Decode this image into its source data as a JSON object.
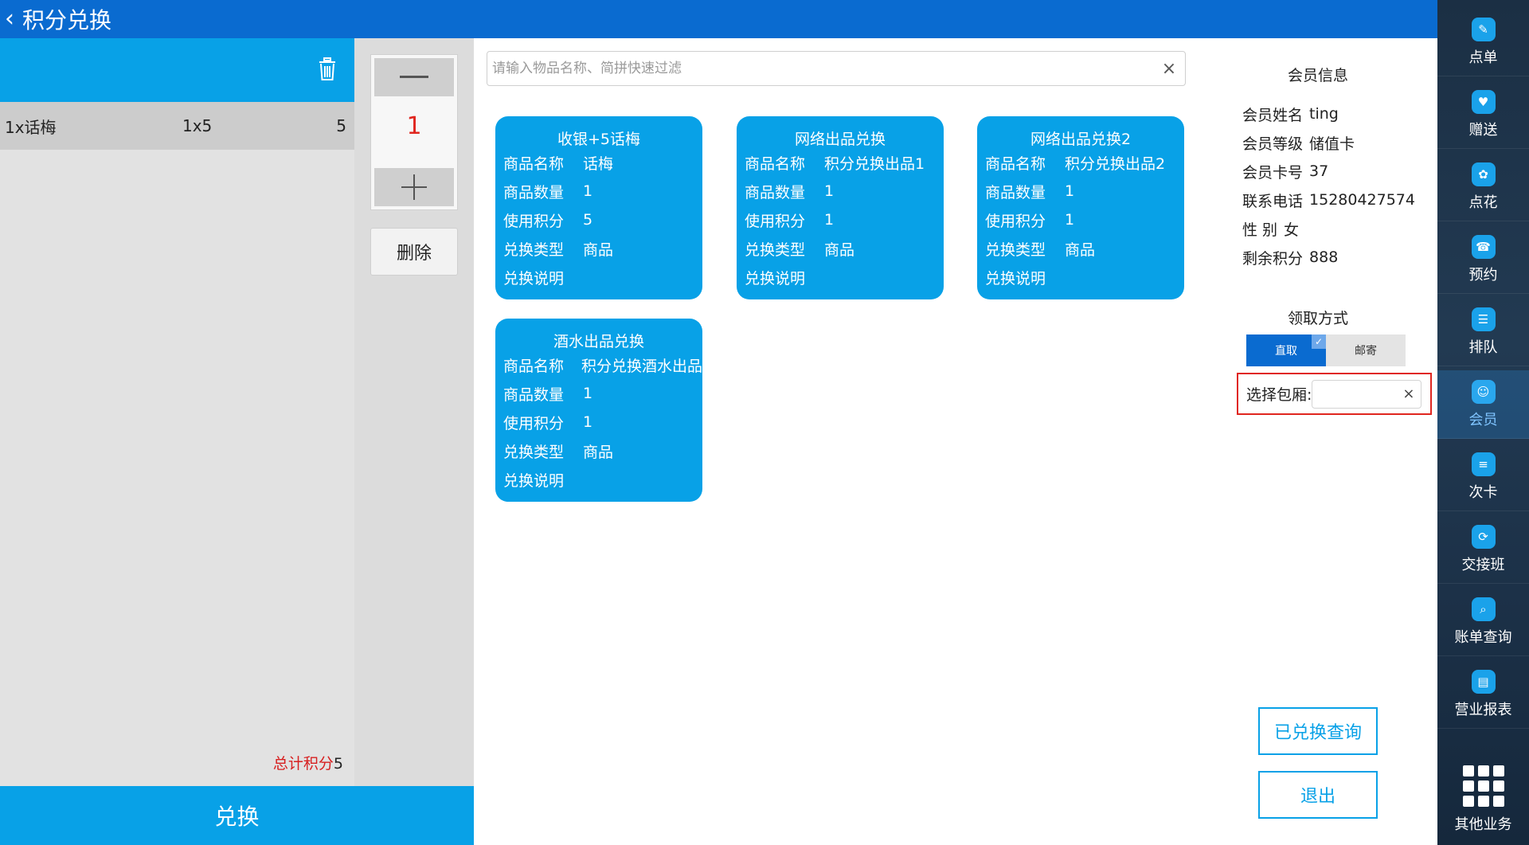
{
  "header": {
    "back_glyph": "‹",
    "title": "积分兑换"
  },
  "order": {
    "items": [
      {
        "name": "1x话梅",
        "qty_expr": "1x5",
        "points": "5"
      }
    ],
    "total_label": "总计积分",
    "total_value": "5",
    "exchange_label": "兑换"
  },
  "quantity": {
    "minus": "—",
    "value": "1",
    "plus": "+",
    "delete_label": "删除"
  },
  "search": {
    "placeholder": "请输入物品名称、简拼快速过滤",
    "clear": "×"
  },
  "field_labels": {
    "name": "商品名称",
    "count": "商品数量",
    "points": "使用积分",
    "type": "兑换类型",
    "desc": "兑换说明"
  },
  "cards": [
    {
      "title": "收银+5话梅",
      "name": "话梅",
      "count": "1",
      "points": "5",
      "type": "商品",
      "desc": ""
    },
    {
      "title": "网络出品兑换",
      "name": "积分兑换出品1",
      "count": "1",
      "points": "1",
      "type": "商品",
      "desc": ""
    },
    {
      "title": "网络出品兑换2",
      "name": "积分兑换出品2",
      "count": "1",
      "points": "1",
      "type": "商品",
      "desc": ""
    },
    {
      "title": "酒水出品兑换",
      "name": "积分兑换酒水出品",
      "count": "1",
      "points": "1",
      "type": "商品",
      "desc": ""
    }
  ],
  "member": {
    "title": "会员信息",
    "rows": [
      {
        "label": "会员姓名",
        "value": "ting"
      },
      {
        "label": "会员等级",
        "value": "储值卡"
      },
      {
        "label": "会员卡号",
        "value": "37"
      },
      {
        "label": "联系电话",
        "value": "15280427574"
      },
      {
        "label": "性 别",
        "value": "女"
      },
      {
        "label": "剩余积分",
        "value": "888"
      }
    ]
  },
  "pickup": {
    "title": "领取方式",
    "option_direct": "直取",
    "option_mail": "邮寄",
    "selected": "直取"
  },
  "room": {
    "label": "选择包厢:",
    "value": "",
    "clear": "×"
  },
  "buttons": {
    "query": "已兑换查询",
    "exit": "退出"
  },
  "sidenav": {
    "items": [
      {
        "label": "点单",
        "icon": "order-icon"
      },
      {
        "label": "赠送",
        "icon": "gift-icon"
      },
      {
        "label": "点花",
        "icon": "flower-icon"
      },
      {
        "label": "预约",
        "icon": "reserve-icon"
      },
      {
        "label": "排队",
        "icon": "queue-icon"
      },
      {
        "label": "会员",
        "icon": "member-icon"
      },
      {
        "label": "次卡",
        "icon": "count-card-icon"
      },
      {
        "label": "交接班",
        "icon": "shift-icon"
      },
      {
        "label": "账单查询",
        "icon": "bill-search-icon"
      },
      {
        "label": "营业报表",
        "icon": "report-icon"
      },
      {
        "label": "其他业务",
        "icon": "grid-icon"
      }
    ],
    "active": "会员"
  },
  "colors": {
    "primary": "#0a6bd0",
    "accent": "#08a1e7",
    "danger": "#e0261f"
  }
}
